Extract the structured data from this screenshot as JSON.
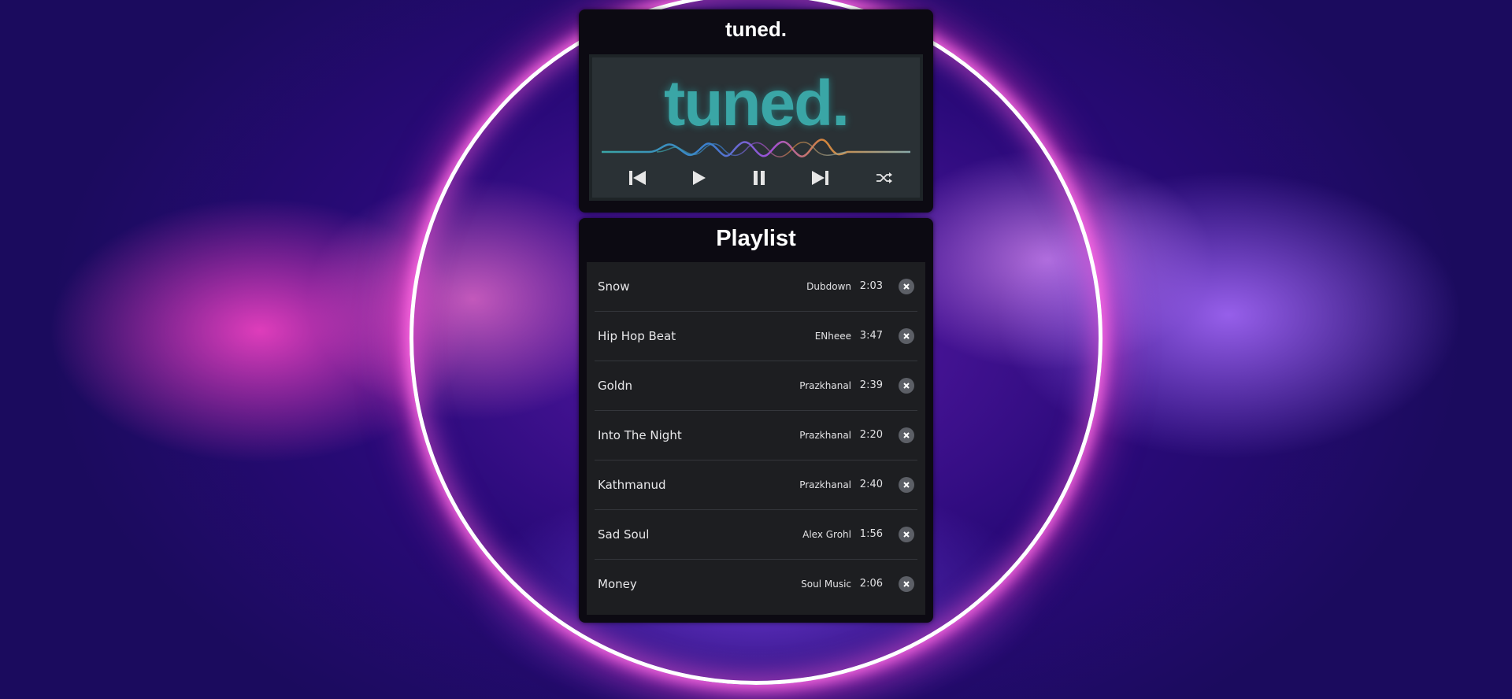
{
  "app": {
    "title": "tuned."
  },
  "player": {
    "logo_text": "tuned.",
    "controls": [
      {
        "name": "previous",
        "icon": "skip-previous-icon"
      },
      {
        "name": "play",
        "icon": "play-icon"
      },
      {
        "name": "pause",
        "icon": "pause-icon"
      },
      {
        "name": "next",
        "icon": "skip-next-icon"
      },
      {
        "name": "shuffle",
        "icon": "shuffle-icon"
      }
    ]
  },
  "playlist": {
    "title": "Playlist",
    "tracks": [
      {
        "title": "Snow",
        "artist": "Dubdown",
        "duration": "2:03"
      },
      {
        "title": "Hip Hop Beat",
        "artist": "ENheee",
        "duration": "3:47"
      },
      {
        "title": "Goldn",
        "artist": "Prazkhanal",
        "duration": "2:39"
      },
      {
        "title": "Into The Night",
        "artist": "Prazkhanal",
        "duration": "2:20"
      },
      {
        "title": "Kathmanud",
        "artist": "Prazkhanal",
        "duration": "2:40"
      },
      {
        "title": "Sad Soul",
        "artist": "Alex Grohl",
        "duration": "1:56"
      },
      {
        "title": "Money",
        "artist": "Soul Music",
        "duration": "2:06"
      }
    ]
  },
  "colors": {
    "panel_bg": "#0c0a12",
    "screen_bg": "#2a3135",
    "logo_teal": "#3aa6a6",
    "list_bg": "#1d1e21",
    "ring": "#ffffff"
  }
}
